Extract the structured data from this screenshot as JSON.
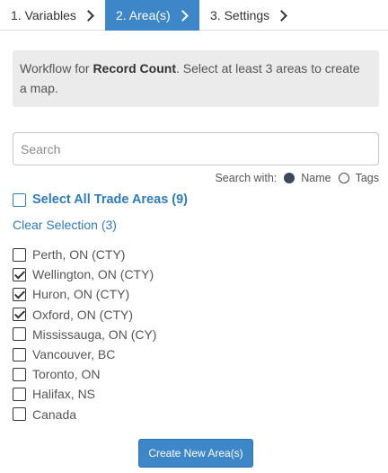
{
  "steps": [
    {
      "label": "1. Variables",
      "active": false
    },
    {
      "label": "2. Area(s)",
      "active": true
    },
    {
      "label": "3. Settings",
      "active": false
    }
  ],
  "info": {
    "prefix": "Workflow for ",
    "workflow": "Record Count",
    "suffix": ". Select at least 3 areas to create a map."
  },
  "search": {
    "placeholder": "Search",
    "value": "",
    "with_label": "Search with:",
    "options": [
      {
        "label": "Name",
        "selected": true
      },
      {
        "label": "Tags",
        "selected": false
      }
    ]
  },
  "select_all": {
    "label": "Select All Trade Areas (9)",
    "checked": false
  },
  "clear_selection": "Clear Selection (3)",
  "areas": [
    {
      "label": "Perth, ON (CTY)",
      "checked": false
    },
    {
      "label": "Wellington, ON (CTY)",
      "checked": true
    },
    {
      "label": "Huron, ON (CTY)",
      "checked": true
    },
    {
      "label": "Oxford, ON (CTY)",
      "checked": true
    },
    {
      "label": "Mississauga, ON (CY)",
      "checked": false
    },
    {
      "label": "Vancouver, BC",
      "checked": false
    },
    {
      "label": "Toronto, ON",
      "checked": false
    },
    {
      "label": "Halifax, NS",
      "checked": false
    },
    {
      "label": "Canada",
      "checked": false
    }
  ],
  "create_button": "Create New Area(s)",
  "colors": {
    "accent": "#3d87c9",
    "link": "#2f7bbf",
    "info_bg": "#ebebeb"
  }
}
